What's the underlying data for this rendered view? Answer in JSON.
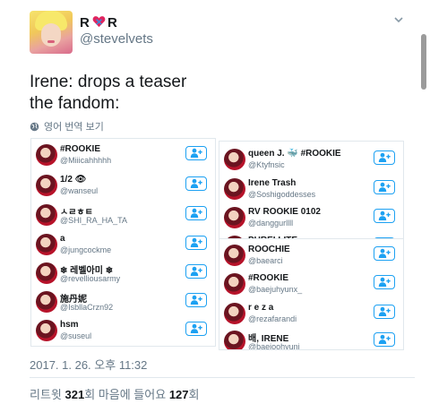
{
  "author": {
    "display_name": "R R",
    "name_left": "R",
    "name_right": "R",
    "handle": "@stevelvets"
  },
  "tweet": {
    "line1": "Irene: drops a teaser",
    "line2": "the fandom:"
  },
  "translate": {
    "label": "영어 번역 보기"
  },
  "panel_left": [
    {
      "name": "#ROOKIE",
      "handle": "@Miiicahhhhh"
    },
    {
      "name": "1/2 👁",
      "handle": "@wanseul"
    },
    {
      "name": "ㅅㄹㅎㅌ",
      "handle": "@SHI_RA_HA_TA"
    },
    {
      "name": "a",
      "handle": "@jungcockme"
    },
    {
      "name": "❄ 레벨아미 ❄",
      "handle": "@revelliousarmy"
    },
    {
      "name": "施丹妮",
      "handle": "@IsbllaCrzn92"
    },
    {
      "name": "hsm",
      "handle": "@suseul"
    }
  ],
  "panel_right_top": [
    {
      "name": "queen J. 🐳 #ROOKIE",
      "handle": "@Ktyfnsic"
    },
    {
      "name": "Irene Trash",
      "handle": "@Soshigoddesses"
    },
    {
      "name": "RV ROOKIE 0102",
      "handle": "@danggurllll"
    },
    {
      "name": "PUREI LITE",
      "handle": ""
    }
  ],
  "panel_right_bottom": [
    {
      "name": "ROOCHIE",
      "handle": "@baearci"
    },
    {
      "name": "#ROOKIE",
      "handle": "@baejuhyunx_"
    },
    {
      "name": "r e z a",
      "handle": "@rezafarandi"
    },
    {
      "name": "배, IRENE",
      "handle": "@baejoohyuni"
    }
  ],
  "timestamp": "2017. 1. 26. 오후 11:32",
  "stats": {
    "retweet_label": "리트윗",
    "retweet_count": "321",
    "retweet_unit": "회",
    "like_label": "마음에 들어요",
    "like_count": "127",
    "like_unit": "회"
  },
  "colors": {
    "accent": "#1da1f2",
    "heart": "#e0245e",
    "muted": "#657786"
  },
  "icons": [
    "heart-icon",
    "chevron-down-icon",
    "globe-icon",
    "follow-icon"
  ]
}
